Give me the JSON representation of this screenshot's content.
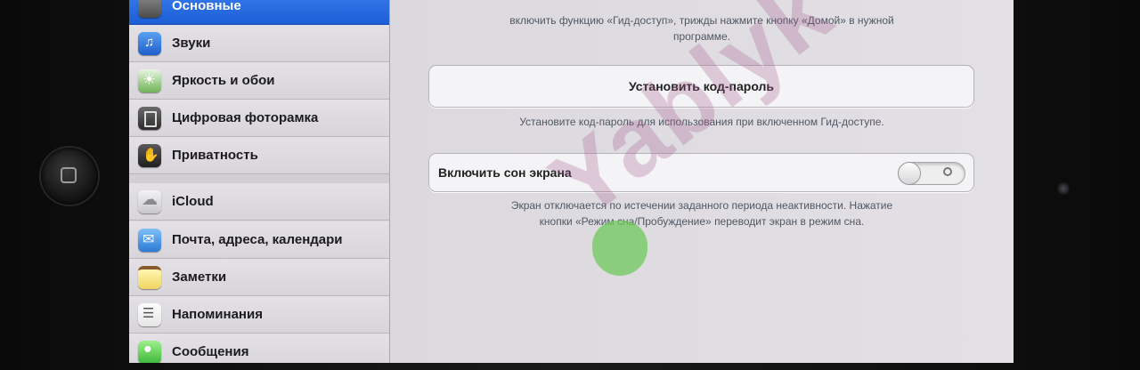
{
  "sidebar": {
    "items": [
      {
        "label": "Основные",
        "icon": "gear-icon",
        "selected": true
      },
      {
        "label": "Звуки",
        "icon": "speaker-icon"
      },
      {
        "label": "Яркость и обои",
        "icon": "brightness-icon"
      },
      {
        "label": "Цифровая фоторамка",
        "icon": "photo-frame-icon"
      },
      {
        "label": "Приватность",
        "icon": "hand-icon"
      },
      {
        "label": "iCloud",
        "icon": "cloud-icon"
      },
      {
        "label": "Почта, адреса, календари",
        "icon": "mail-icon"
      },
      {
        "label": "Заметки",
        "icon": "notes-icon"
      },
      {
        "label": "Напоминания",
        "icon": "reminders-icon"
      },
      {
        "label": "Сообщения",
        "icon": "messages-icon"
      }
    ]
  },
  "detail": {
    "top_text_1": "включить функцию «Гид-доступ», трижды нажмите кнопку «Домой» в нужной",
    "top_text_2": "программе.",
    "passcode_button": "Установить код-пароль",
    "passcode_hint": "Установите код-пароль для использования при включенном Гид-доступе.",
    "toggle_label": "Включить сон экрана",
    "toggle_on": false,
    "toggle_hint_1": "Экран отключается по истечении заданного периода неактивности. Нажатие",
    "toggle_hint_2": "кнопки «Режим сна/Пробуждение» переводит экран в режим сна."
  },
  "watermark": "Yablyk",
  "colors": {
    "selected_accent": "#1c5fd6",
    "hint_text": "#4f5763",
    "watermark": "#a05a8c",
    "watermark_apple": "#6ec85a"
  }
}
